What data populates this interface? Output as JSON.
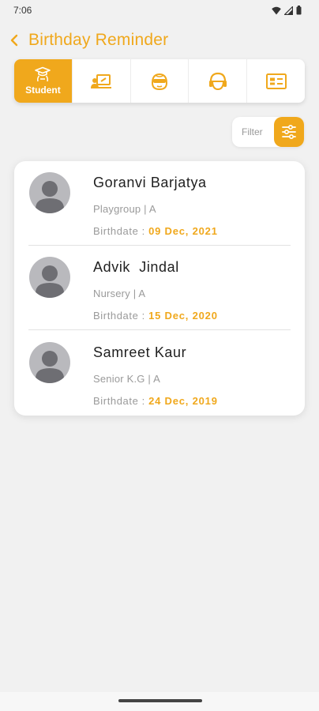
{
  "status_bar": {
    "time": "7:06",
    "icons": [
      "wifi-icon",
      "signal-icon",
      "battery-icon"
    ]
  },
  "header": {
    "back_icon": "chevron-left-icon",
    "title": "Birthday Reminder"
  },
  "tabs": [
    {
      "name": "student",
      "label": "Student",
      "icon": "graduation-cap-icon",
      "active": true
    },
    {
      "name": "teacher",
      "label": "",
      "icon": "teacher-board-icon",
      "active": false
    },
    {
      "name": "driver",
      "label": "",
      "icon": "driver-helmet-icon",
      "active": false
    },
    {
      "name": "staff",
      "label": "",
      "icon": "staff-headset-icon",
      "active": false
    },
    {
      "name": "other",
      "label": "",
      "icon": "id-card-icon",
      "active": false
    }
  ],
  "filter": {
    "label": "Filter",
    "icon": "sliders-icon"
  },
  "birthdays": [
    {
      "name": "Goranvi Barjatya",
      "class": "Playgroup | A",
      "birthdate_label": "Birthdate :",
      "date": "09 Dec, 2021"
    },
    {
      "name": "Advik  Jindal",
      "class": "Nursery | A",
      "birthdate_label": "Birthdate :",
      "date": "15 Dec, 2020"
    },
    {
      "name": "Samreet Kaur",
      "class": "Senior K.G | A",
      "birthdate_label": "Birthdate :",
      "date": "24 Dec, 2019"
    }
  ],
  "colors": {
    "accent": "#f0a81c",
    "background": "#f1f1f1",
    "card": "#ffffff",
    "avatar": "#b9b9bd"
  }
}
